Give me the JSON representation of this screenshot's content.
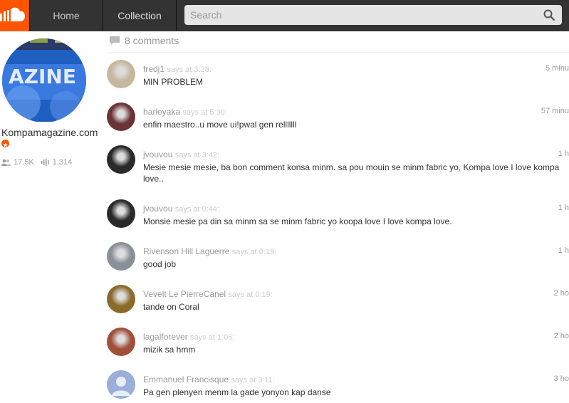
{
  "nav": {
    "home_label": "Home",
    "collection_label": "Collection",
    "search_placeholder": "Search"
  },
  "profile": {
    "avatar_text": "AZINE",
    "name": "Kompamagazine.com",
    "followers": "17.5K",
    "tracks": "1,314"
  },
  "comments_header": "8 comments",
  "comments": [
    {
      "user": "fredj1",
      "says": "says at 3:28:",
      "text": "MIN PROBLEM",
      "time": "5 minu",
      "avatar_color": "#c7b7a0"
    },
    {
      "user": "harleyaka",
      "says": "says at 5:30:",
      "text": "enfin maestro..u move ui!pwal gen relllllll",
      "time": "57 minu",
      "avatar_color": "#6b3434"
    },
    {
      "user": "jvouvou",
      "says": "says at 3:42:",
      "text": "Mesie mesie mesie, ba bon comment konsa minm. sa pou mouin se minm fabric yo, Kompa love I love kompa love..",
      "time": "1 h",
      "avatar_color": "#2a2a2a"
    },
    {
      "user": "jvouvou",
      "says": "says at 0:44:",
      "text": "Monsie mesie pa din sa minm sa se minm fabric yo koopa love I love kompa love.",
      "time": "1 h",
      "avatar_color": "#2a2a2a"
    },
    {
      "user": "Rivenson Hill Laguerre",
      "says": "says at 0:19:",
      "text": "good job",
      "time": "1 h",
      "avatar_color": "#8a9099"
    },
    {
      "user": "Vevelt Le PierreCanel",
      "says": "says at 0:19:",
      "text": "tande on Coral",
      "time": "2 ho",
      "avatar_color": "#8a6b2a"
    },
    {
      "user": "lagalforever",
      "says": "says at 1:06:",
      "text": "mizik sa hmm",
      "time": "2 ho",
      "avatar_color": "#a0503a"
    },
    {
      "user": "Emmanuel Francisque",
      "says": "says at 3:11:",
      "text": "Pa gen plenyen menm la gade yonyon kap danse",
      "time": "3 ho",
      "avatar_color": "#9aaed8"
    }
  ],
  "colors": {
    "brand": "#ff5500",
    "topbar": "#333333"
  }
}
